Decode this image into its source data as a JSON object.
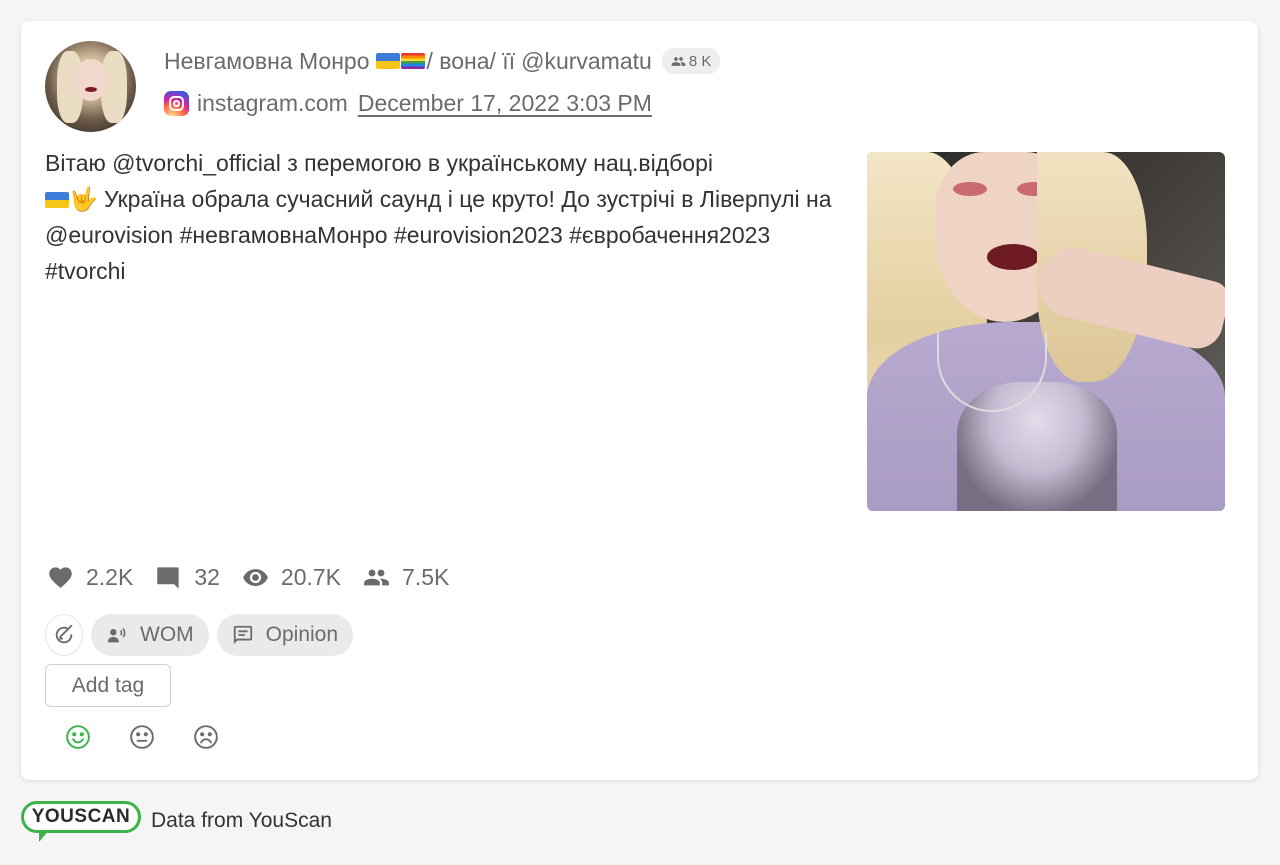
{
  "author": {
    "name": "Невгамовна Монро",
    "pronouns": "/ вона/ її",
    "handle": "@kurvamatu",
    "followers_badge": "8 K"
  },
  "source": {
    "platform": "instagram.com",
    "date": "December 17, 2022 3:03 PM"
  },
  "post": {
    "text_part1": "Вітаю @tvorchi_official з перемогою в українському нац.відборі",
    "text_part2": "🤟 Україна обрала сучасний саунд і це круто! До зустрічі в Ліверпулі на @eurovision #невгамовнаМонро #eurovision2023 #євробачення2023 #tvorchi"
  },
  "metrics": {
    "likes": "2.2K",
    "comments": "32",
    "views": "20.7K",
    "reach": "7.5K"
  },
  "tags": {
    "chips": [
      "WOM",
      "Opinion"
    ],
    "add_tag_label": "Add tag"
  },
  "footer": {
    "logo_text": "YOUSCAN",
    "text": "Data from YouScan"
  },
  "colors": {
    "accent_green": "#3bb34a",
    "muted_text": "#6b6b6b"
  },
  "icons": [
    "heart-icon",
    "comment-icon",
    "eye-icon",
    "people-icon",
    "instagram-icon",
    "check-edit-icon",
    "megaphone-icon",
    "opinion-icon",
    "smile-icon",
    "neutral-icon",
    "sad-icon"
  ]
}
